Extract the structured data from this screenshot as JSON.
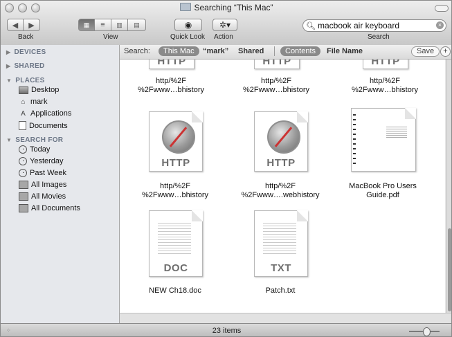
{
  "window": {
    "title": "Searching “This Mac”"
  },
  "toolbar": {
    "back_label": "Back",
    "view_label": "View",
    "quicklook_label": "Quick Look",
    "action_label": "Action",
    "search_label": "Search",
    "search_value": "macbook air keyboard"
  },
  "sidebar": {
    "devices": "DEVICES",
    "shared": "SHARED",
    "places": "PLACES",
    "places_items": [
      "Desktop",
      "mark",
      "Applications",
      "Documents"
    ],
    "search_for": "SEARCH FOR",
    "search_items": [
      "Today",
      "Yesterday",
      "Past Week",
      "All Images",
      "All Movies",
      "All Documents"
    ]
  },
  "scope": {
    "search_label": "Search:",
    "this_mac": "This Mac",
    "mark": "“mark”",
    "shared": "Shared",
    "contents": "Contents",
    "file_name": "File Name",
    "save": "Save",
    "plus": "+"
  },
  "files": [
    {
      "name": "http/%2F\n%2Fwww…bhistory",
      "ext": "HTTP"
    },
    {
      "name": "http/%2F\n%2Fwww…bhistory",
      "ext": "HTTP"
    },
    {
      "name": "http/%2F\n%2Fwww…bhistory",
      "ext": "HTTP"
    },
    {
      "name": "http/%2F\n%2Fwww…bhistory",
      "ext": "HTTP"
    },
    {
      "name": "http/%2F\n%2Fwww….webhistory",
      "ext": "HTTP"
    },
    {
      "name": "MacBook Pro Users\nGuide.pdf",
      "ext": ""
    },
    {
      "name": "NEW Ch18.doc",
      "ext": "DOC"
    },
    {
      "name": "Patch.txt",
      "ext": "TXT"
    }
  ],
  "status": {
    "count": "23 items"
  }
}
